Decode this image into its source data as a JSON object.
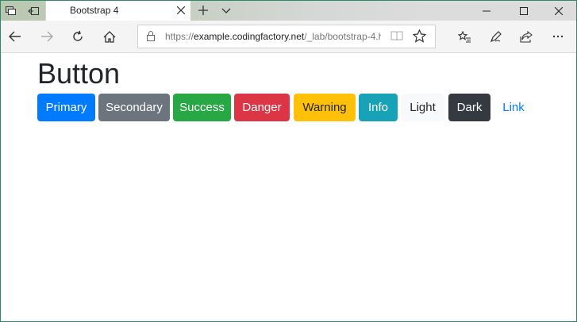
{
  "browser": {
    "tab_title": "Bootstrap 4",
    "url_prefix": "https://",
    "url_domain": "example.codingfactory.net",
    "url_path": "/_lab/bootstrap-4.ht"
  },
  "page": {
    "heading": "Button",
    "buttons": [
      {
        "label": "Primary",
        "color": "#007bff"
      },
      {
        "label": "Secondary",
        "color": "#6c757d"
      },
      {
        "label": "Success",
        "color": "#28a745"
      },
      {
        "label": "Danger",
        "color": "#dc3545"
      },
      {
        "label": "Warning",
        "color": "#ffc107"
      },
      {
        "label": "Info",
        "color": "#17a2b8"
      },
      {
        "label": "Light",
        "color": "#f8f9fa"
      },
      {
        "label": "Dark",
        "color": "#343a40"
      },
      {
        "label": "Link",
        "color": "#007bff"
      }
    ]
  }
}
